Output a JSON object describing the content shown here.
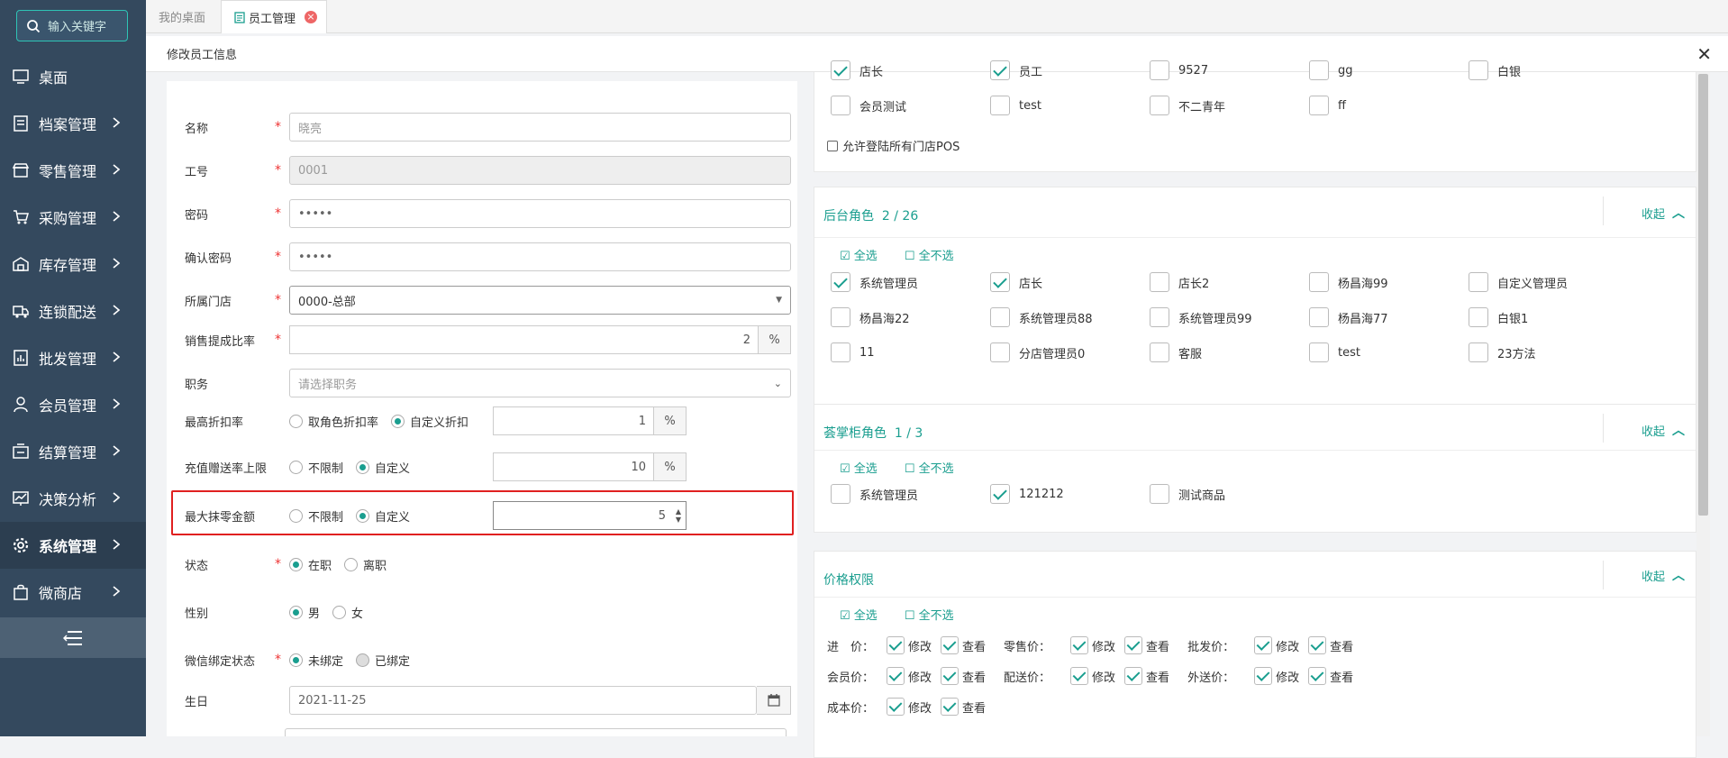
{
  "sidebar": {
    "search_placeholder": "输入关键字",
    "items": [
      {
        "label": "桌面",
        "icon": "monitor-icon"
      },
      {
        "label": "档案管理",
        "icon": "archive-icon"
      },
      {
        "label": "零售管理",
        "icon": "store-icon"
      },
      {
        "label": "采购管理",
        "icon": "cart-icon"
      },
      {
        "label": "库存管理",
        "icon": "warehouse-icon"
      },
      {
        "label": "连锁配送",
        "icon": "truck-icon"
      },
      {
        "label": "批发管理",
        "icon": "chart-doc-icon"
      },
      {
        "label": "会员管理",
        "icon": "user-icon"
      },
      {
        "label": "结算管理",
        "icon": "wallet-icon"
      },
      {
        "label": "决策分析",
        "icon": "analytics-icon"
      },
      {
        "label": "系统管理",
        "icon": "gear-icon"
      },
      {
        "label": "微商店",
        "icon": "shop-bag-icon"
      }
    ]
  },
  "tabs": {
    "home": "我的桌面",
    "current": "员工管理"
  },
  "panel": {
    "title": "修改员工信息"
  },
  "form": {
    "name": {
      "label": "名称",
      "value": "晓亮"
    },
    "job_no": {
      "label": "工号",
      "value": "0001"
    },
    "password": {
      "label": "密码",
      "value": "•••••"
    },
    "confirm": {
      "label": "确认密码",
      "value": "•••••"
    },
    "store": {
      "label": "所属门店",
      "value": "0000-总部"
    },
    "commission": {
      "label": "销售提成比率",
      "value": "2",
      "unit": "%"
    },
    "position": {
      "label": "职务",
      "placeholder": "请选择职务"
    },
    "discount": {
      "label": "最高折扣率",
      "opt1": "取角色折扣率",
      "opt2": "自定义折扣",
      "value": "1",
      "unit": "%"
    },
    "recharge": {
      "label": "充值赠送率上限",
      "opt1": "不限制",
      "opt2": "自定义",
      "value": "10",
      "unit": "%"
    },
    "round": {
      "label": "最大抹零金额",
      "opt1": "不限制",
      "opt2": "自定义",
      "value": "5"
    },
    "status": {
      "label": "状态",
      "opt1": "在职",
      "opt2": "离职"
    },
    "gender": {
      "label": "性别",
      "opt1": "男",
      "opt2": "女"
    },
    "wechat": {
      "label": "微信绑定状态",
      "opt1": "未绑定",
      "opt2": "已绑定"
    },
    "birthday": {
      "label": "生日",
      "value": "2021-11-25"
    }
  },
  "pos_roles": {
    "row1": [
      {
        "t": "店长",
        "on": true
      },
      {
        "t": "员工",
        "on": true
      },
      {
        "t": "9527",
        "on": false
      },
      {
        "t": "gg",
        "on": false
      },
      {
        "t": "白银",
        "on": false
      }
    ],
    "row2": [
      {
        "t": "会员测试",
        "on": false
      },
      {
        "t": "test",
        "on": false
      },
      {
        "t": "不二青年",
        "on": false
      },
      {
        "t": "ff",
        "on": false
      }
    ],
    "allow_all": "允许登陆所有门店POS"
  },
  "backend": {
    "title": "后台角色",
    "count": "2 / 26",
    "toggle": "收起",
    "select_all": "全选",
    "select_none": "全不选",
    "rows": [
      [
        {
          "t": "系统管理员",
          "on": true
        },
        {
          "t": "店长",
          "on": true
        },
        {
          "t": "店长2",
          "on": false
        },
        {
          "t": "杨昌海99",
          "on": false
        },
        {
          "t": "自定义管理员",
          "on": false
        }
      ],
      [
        {
          "t": "杨昌海22",
          "on": false
        },
        {
          "t": "系统管理员88",
          "on": false
        },
        {
          "t": "系统管理员99",
          "on": false
        },
        {
          "t": "杨昌海77",
          "on": false
        },
        {
          "t": "白银1",
          "on": false
        }
      ],
      [
        {
          "t": "11",
          "on": false
        },
        {
          "t": "分店管理员0",
          "on": false
        },
        {
          "t": "客服",
          "on": false
        },
        {
          "t": "test",
          "on": false
        },
        {
          "t": "23方法",
          "on": false
        }
      ]
    ]
  },
  "cabinet": {
    "title": "荟掌柜角色",
    "count": "1 / 3",
    "toggle": "收起",
    "select_all": "全选",
    "select_none": "全不选",
    "rows": [
      [
        {
          "t": "系统管理员",
          "on": false
        },
        {
          "t": "121212",
          "on": true
        },
        {
          "t": "测试商品",
          "on": false
        }
      ]
    ]
  },
  "price": {
    "title": "价格权限",
    "toggle": "收起",
    "select_all": "全选",
    "select_none": "全不选",
    "edit": "修改",
    "view": "查看",
    "rows": [
      [
        "进　价：",
        "零售价：",
        "批发价："
      ],
      [
        "会员价：",
        "配送价：",
        "外送价："
      ],
      [
        "成本价："
      ]
    ]
  },
  "colors": {
    "accent": "#1a9e8f",
    "sidebar": "#34495e",
    "highlight": "#e02020"
  }
}
